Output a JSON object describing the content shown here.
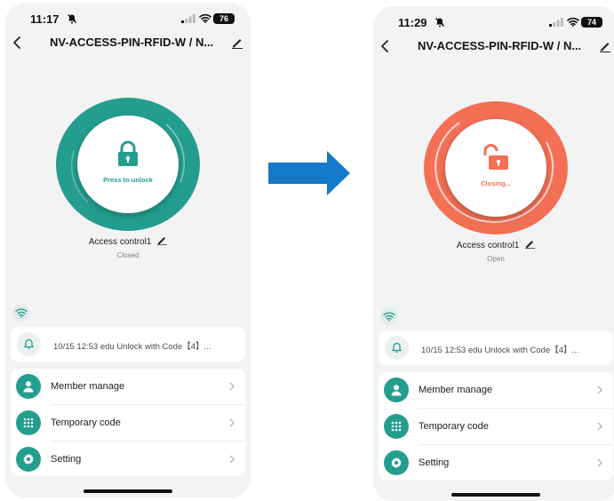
{
  "left_phone": {
    "status": {
      "time": "11:17",
      "battery": "76"
    },
    "header": {
      "title": "NV-ACCESS-PIN-RFID-W / N..."
    },
    "lock_button": {
      "label": "Press to unlock",
      "icon": "lock-closed-icon"
    },
    "device": {
      "name": "Access control1",
      "state": "Closed"
    },
    "log": {
      "text": "10/15 12:53 edu  Unlock with Code【4】..."
    },
    "menu": [
      {
        "label": "Member manage",
        "icon": "person-icon"
      },
      {
        "label": "Temporary code",
        "icon": "keypad-icon"
      },
      {
        "label": "Setting",
        "icon": "gear-icon"
      }
    ]
  },
  "right_phone": {
    "status": {
      "time": "11:29",
      "battery": "74"
    },
    "header": {
      "title": "NV-ACCESS-PIN-RFID-W / N..."
    },
    "lock_button": {
      "label": "Closing...",
      "icon": "lock-open-icon"
    },
    "device": {
      "name": "Access control1",
      "state": "Open"
    },
    "log": {
      "text": "10/15 12:53 edu  Unlock with Code【4】..."
    },
    "menu": [
      {
        "label": "Member manage",
        "icon": "person-icon"
      },
      {
        "label": "Temporary code",
        "icon": "keypad-icon"
      },
      {
        "label": "Setting",
        "icon": "gear-icon"
      }
    ]
  },
  "colors": {
    "teal": "#239e8e",
    "coral": "#f37055",
    "arrow_blue": "#1479c9",
    "background": "#f3f3f3"
  }
}
